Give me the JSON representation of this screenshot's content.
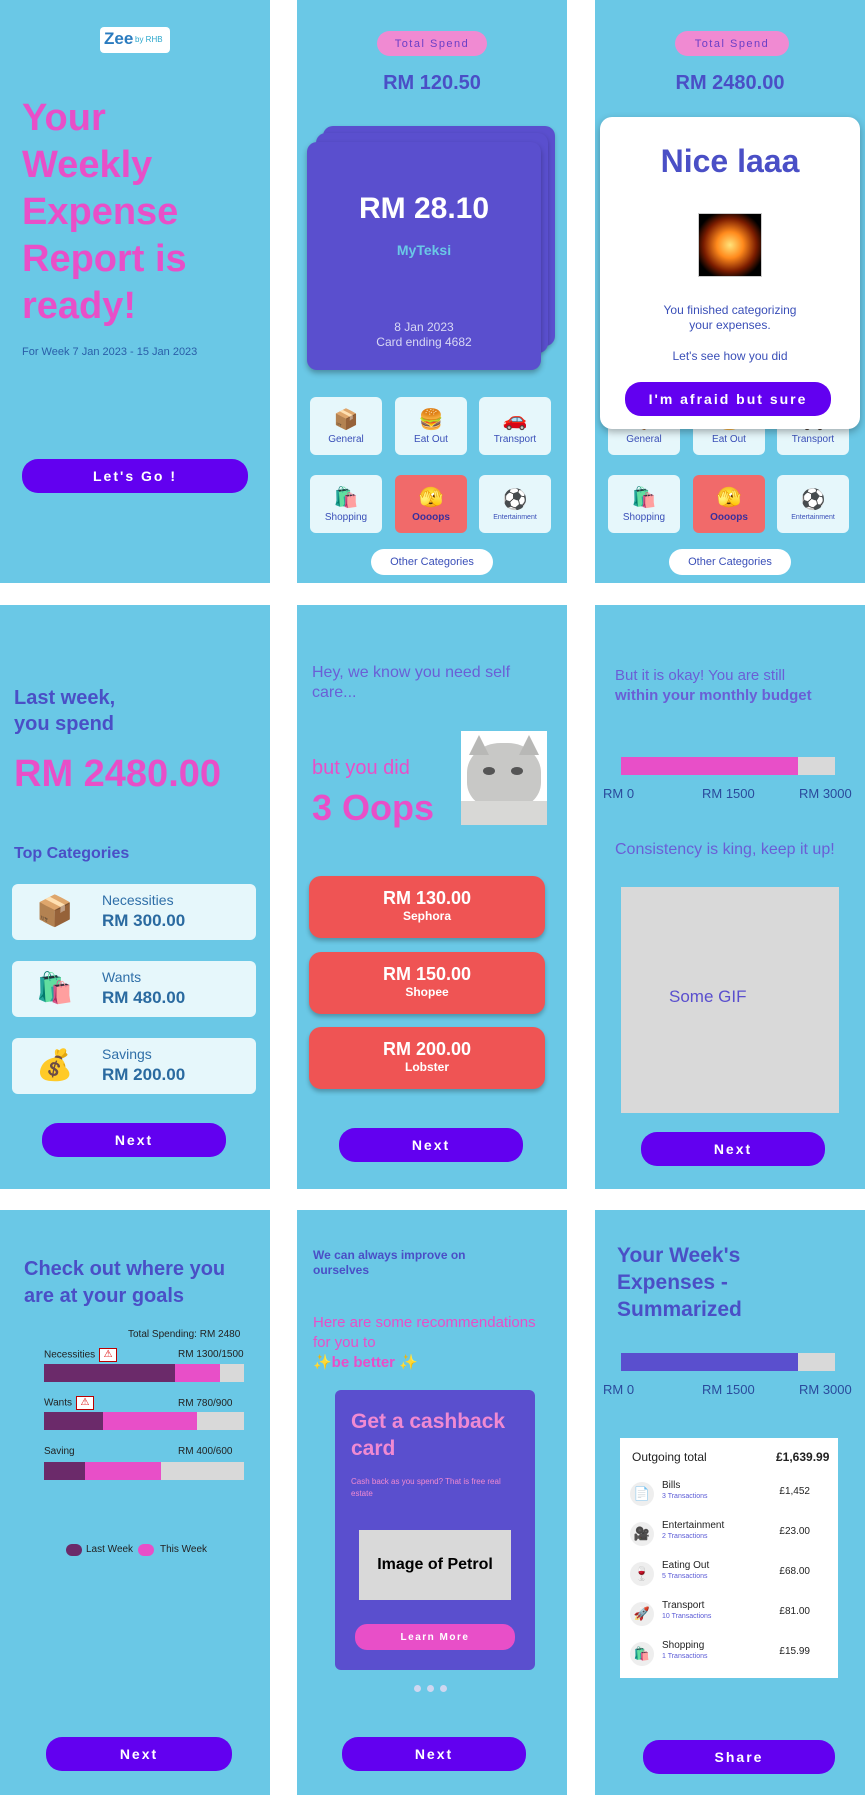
{
  "colors": {
    "bg": "#6ac8e6",
    "brand_purple": "#6200f0",
    "card_purple": "#5a4fce",
    "pink": "#e84fc8",
    "oops_red": "#ef5454",
    "last_week": "#6b2a6a",
    "this_week": "#e84fc8",
    "bar_grey": "#d9d9d9"
  },
  "s1": {
    "logo_main": "Zee",
    "logo_sub": "by RHB",
    "headline": [
      "Your",
      "Weekly",
      "Expense",
      "Report is",
      "ready!"
    ],
    "week_range": "For Week 7 Jan 2023 - 15 Jan 2023",
    "cta": "Let's Go !"
  },
  "s2": {
    "pill": "Total Spend",
    "total": "RM 120.50",
    "card_amount": "RM 28.10",
    "card_merchant": "MyTeksi",
    "card_date": "8 Jan 2023",
    "card_ending": "Card ending 4682",
    "other": "Other Categories"
  },
  "categories": [
    {
      "label": "General",
      "icon": "📦"
    },
    {
      "label": "Eat Out",
      "icon": "🍔"
    },
    {
      "label": "Transport",
      "icon": "🚗"
    },
    {
      "label": "Shopping",
      "icon": "🛍️"
    },
    {
      "label": "Oooops",
      "icon": "🫣"
    },
    {
      "label": "Entertainment",
      "icon": "⚽"
    }
  ],
  "s3": {
    "pill": "Total Spend",
    "total": "RM 2480.00",
    "modal_title": "Nice laaa",
    "modal_text1": "You finished categorizing",
    "modal_text2": "your expenses.",
    "modal_text3": "Let's see how you did",
    "modal_cta": "I'm afraid but sure",
    "other": "Other Categories"
  },
  "s4": {
    "line1": "Last week,",
    "line2": "you spend",
    "amount": "RM 2480.00",
    "top_title": "Top Categories",
    "items": [
      {
        "name": "Necessities",
        "amount": "RM 300.00",
        "icon": "📦"
      },
      {
        "name": "Wants",
        "amount": "RM 480.00",
        "icon": "🛍️"
      },
      {
        "name": "Savings",
        "amount": "RM 200.00",
        "icon": "💰"
      }
    ],
    "cta": "Next"
  },
  "s5": {
    "intro": "Hey, we know you need self care...",
    "but": "but you did",
    "oops": "3 Oops",
    "items": [
      {
        "amount": "RM 130.00",
        "merchant": "Sephora"
      },
      {
        "amount": "RM 150.00",
        "merchant": "Shopee"
      },
      {
        "amount": "RM 200.00",
        "merchant": "Lobster"
      }
    ],
    "cta": "Next"
  },
  "s6": {
    "line1": "But it is okay! You are still",
    "line2": "within your monthly budget",
    "bar_fraction": 0.827,
    "ticks": [
      "RM 0",
      "RM 1500",
      "RM 3000"
    ],
    "consistency": "Consistency is king, keep it up!",
    "gif": "Some GIF",
    "cta": "Next"
  },
  "s7": {
    "title": "Check out where you are at your goals",
    "total": "Total Spending: RM 2480",
    "goals": [
      {
        "label": "Necessities",
        "value": "RM 1300/1500",
        "last": 1300,
        "current": 1500,
        "limit": 1500,
        "warn": true
      },
      {
        "label": "Wants",
        "value": "RM 780/900",
        "last": 300,
        "current": 780,
        "limit": 900,
        "warn": true
      },
      {
        "label": "Saving",
        "value": "RM 400/600",
        "last": 140,
        "current": 400,
        "limit": 600,
        "warn": false
      }
    ],
    "legend_last": "Last Week",
    "legend_this": "This Week",
    "cta": "Next"
  },
  "s8": {
    "intro": "We can always improve on ourselves",
    "rec1": "Here are some recommendations for you to",
    "rec2": "✨be better ✨",
    "card_title": "Get a cashback card",
    "card_sub": "Cash back as you spend? That is free real estate",
    "image": "Image of Petrol",
    "learn": "Learn More",
    "cta": "Next"
  },
  "s9": {
    "title": "Your Week's Expenses - Summarized",
    "bar_fraction": 0.827,
    "ticks": [
      "RM 0",
      "RM 1500",
      "RM 3000"
    ],
    "outgoing_label": "Outgoing total",
    "outgoing_value": "£1,639.99",
    "rows": [
      {
        "name": "Bills",
        "sub": "3 Transactions",
        "amount": "£1,452",
        "icon": "📄"
      },
      {
        "name": "Entertainment",
        "sub": "2 Transactions",
        "amount": "£23.00",
        "icon": "🎥"
      },
      {
        "name": "Eating Out",
        "sub": "5 Transactions",
        "amount": "£68.00",
        "icon": "🍷"
      },
      {
        "name": "Transport",
        "sub": "10 Transactions",
        "amount": "£81.00",
        "icon": "🚀"
      },
      {
        "name": "Shopping",
        "sub": "1 Transactions",
        "amount": "£15.99",
        "icon": "🛍️"
      }
    ],
    "cta": "Share"
  }
}
